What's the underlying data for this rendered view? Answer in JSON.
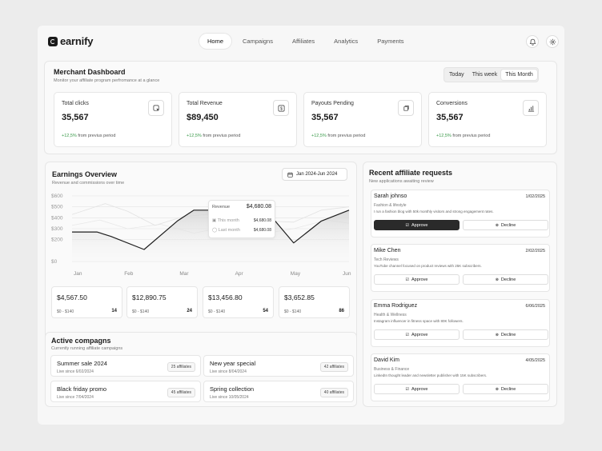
{
  "brand": {
    "name": "earnify"
  },
  "nav": [
    "Home",
    "Campaigns",
    "Affiliates",
    "Analytics",
    "Payments"
  ],
  "header_icons": [
    "bell-icon",
    "gear-icon"
  ],
  "dashboard": {
    "title": "Merchant Dashboard",
    "subtitle": "Monitor your affiliate program perfromance at a glance",
    "periods": [
      "Today",
      "This week",
      "This Month"
    ],
    "active_period": "This Month",
    "stats": [
      {
        "label": "Total clicks",
        "value": "35,567",
        "delta": "+12,5%",
        "delta_text": "from previus period",
        "icon": "cursor-click-icon"
      },
      {
        "label": "Total Revenue",
        "value": "$89,450",
        "delta": "+12,5%",
        "delta_text": "from previus period",
        "icon": "dollar-icon"
      },
      {
        "label": "Payouts Pending",
        "value": "35,567",
        "delta": "+12,5%",
        "delta_text": "from previus period",
        "icon": "payout-icon"
      },
      {
        "label": "Conversions",
        "value": "35,567",
        "delta": "+12,5%",
        "delta_text": "from previus period",
        "icon": "bar-chart-icon"
      }
    ]
  },
  "earnings": {
    "title": "Earnings Overview",
    "subtitle": "Revenue and commissions over time",
    "date_range": "Jan 2024-Jun 2024",
    "tooltip": {
      "title": "Revenue",
      "total": "$4,680.08",
      "rows": [
        {
          "label": "This month",
          "value": "$4,680.08"
        },
        {
          "label": "Last month",
          "value": "$4,680.08"
        }
      ]
    },
    "mini_stats": [
      {
        "value": "$4,567.50",
        "range": "$0 - $140",
        "count": "14"
      },
      {
        "value": "$12,890.75",
        "range": "$0 - $140",
        "count": "24"
      },
      {
        "value": "$13,456.80",
        "range": "$0 - $140",
        "count": "54"
      },
      {
        "value": "$3,652.85",
        "range": "$0 - $140",
        "count": "86"
      }
    ]
  },
  "chart_data": {
    "type": "line",
    "categories": [
      "Jan",
      "Feb",
      "Mar",
      "Apr",
      "May",
      "Jun"
    ],
    "yticks": [
      "$600",
      "$500",
      "$400",
      "$300",
      "$200",
      "$0"
    ],
    "ylim": [
      0,
      600
    ],
    "series": [
      {
        "x": [
          0,
          0.45,
          0.7,
          1.3,
          1.9,
          2.2,
          2.7,
          3.0,
          3.5,
          4.0,
          4.5,
          5.0
        ],
        "values": [
          270,
          270,
          230,
          110,
          370,
          470,
          470,
          470,
          470,
          170,
          370,
          470
        ]
      },
      {
        "x": [
          0,
          0.6,
          1.0,
          1.5,
          2.0,
          2.6,
          3.0,
          3.5,
          4.0,
          4.5,
          5.0
        ],
        "values": [
          430,
          530,
          460,
          330,
          410,
          440,
          500,
          370,
          360,
          470,
          500
        ]
      },
      {
        "x": [
          0,
          0.5,
          1.0,
          1.6,
          2.2,
          2.8,
          3.4,
          4.0,
          4.6,
          5.0
        ],
        "values": [
          330,
          380,
          300,
          340,
          260,
          320,
          250,
          300,
          380,
          350
        ]
      }
    ]
  },
  "campaigns": {
    "title": "Active compagns",
    "subtitle": "Currently running affiliate campaigns",
    "items": [
      {
        "name": "Summer sale 2024",
        "since": "Live since 6/02/2024",
        "badge": "25 affiliates"
      },
      {
        "name": "New year special",
        "since": "Live since 8/04/2024",
        "badge": "42 affiliates"
      },
      {
        "name": "Black friday promo",
        "since": "Live since 7/04/2024",
        "badge": "45 affiliates"
      },
      {
        "name": "Spring collection",
        "since": "Live since 10/05/2024",
        "badge": "40 affiliates"
      }
    ]
  },
  "requests": {
    "title": "Recent affiliate requests",
    "subtitle": "New applications awaiting review",
    "approve_label": "Approve",
    "decline_label": "Decline",
    "items": [
      {
        "name": "Sarah johnso",
        "date": "1/02/2025",
        "category": "Fashion & lifestyle",
        "desc": "I run a fashion blog with 50k monthly visitors and strong engagement rates."
      },
      {
        "name": "Mike Chen",
        "date": "2/02/2025",
        "category": "Tech Reviews",
        "desc": "YouTube channel focused on product reviews with 25K subscribers."
      },
      {
        "name": "Emma Rodriguez",
        "date": "6/06/2025",
        "category": "Health & Wellness",
        "desc": "Instagram influencer in fitness space with 80K followers."
      },
      {
        "name": "David Kim",
        "date": "4/05/2025",
        "category": "Business & Finance",
        "desc": "LinkedIn thought leader and newsletter publisher with 15K subscribers."
      }
    ]
  }
}
